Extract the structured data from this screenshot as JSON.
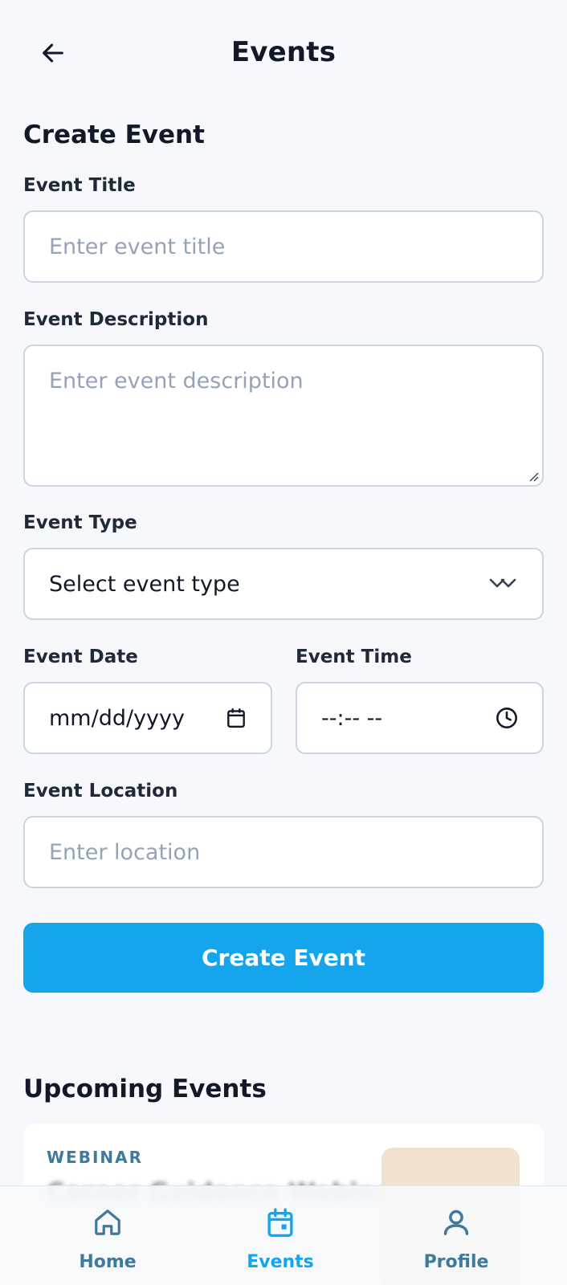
{
  "header": {
    "title": "Events"
  },
  "form": {
    "section_title": "Create Event",
    "title_label": "Event Title",
    "title_placeholder": "Enter event title",
    "description_label": "Event Description",
    "description_placeholder": "Enter event description",
    "type_label": "Event Type",
    "type_selected": "Select event type",
    "date_label": "Event Date",
    "date_value": "mm/dd/yyyy",
    "time_label": "Event Time",
    "time_value": "--:-- --",
    "location_label": "Event Location",
    "location_placeholder": "Enter location",
    "submit_label": "Create Event"
  },
  "upcoming": {
    "section_title": "Upcoming Events",
    "cards": [
      {
        "type": "WEBINAR",
        "title": "Career Guidance Webinar"
      }
    ]
  },
  "nav": {
    "items": [
      {
        "label": "Home",
        "icon": "home-icon",
        "active": false
      },
      {
        "label": "Events",
        "icon": "calendar-icon",
        "active": true
      },
      {
        "label": "Profile",
        "icon": "user-icon",
        "active": false
      }
    ]
  },
  "colors": {
    "accent": "#14a5ec",
    "nav_inactive": "#3d7a9e",
    "background": "#f6f8fb"
  }
}
